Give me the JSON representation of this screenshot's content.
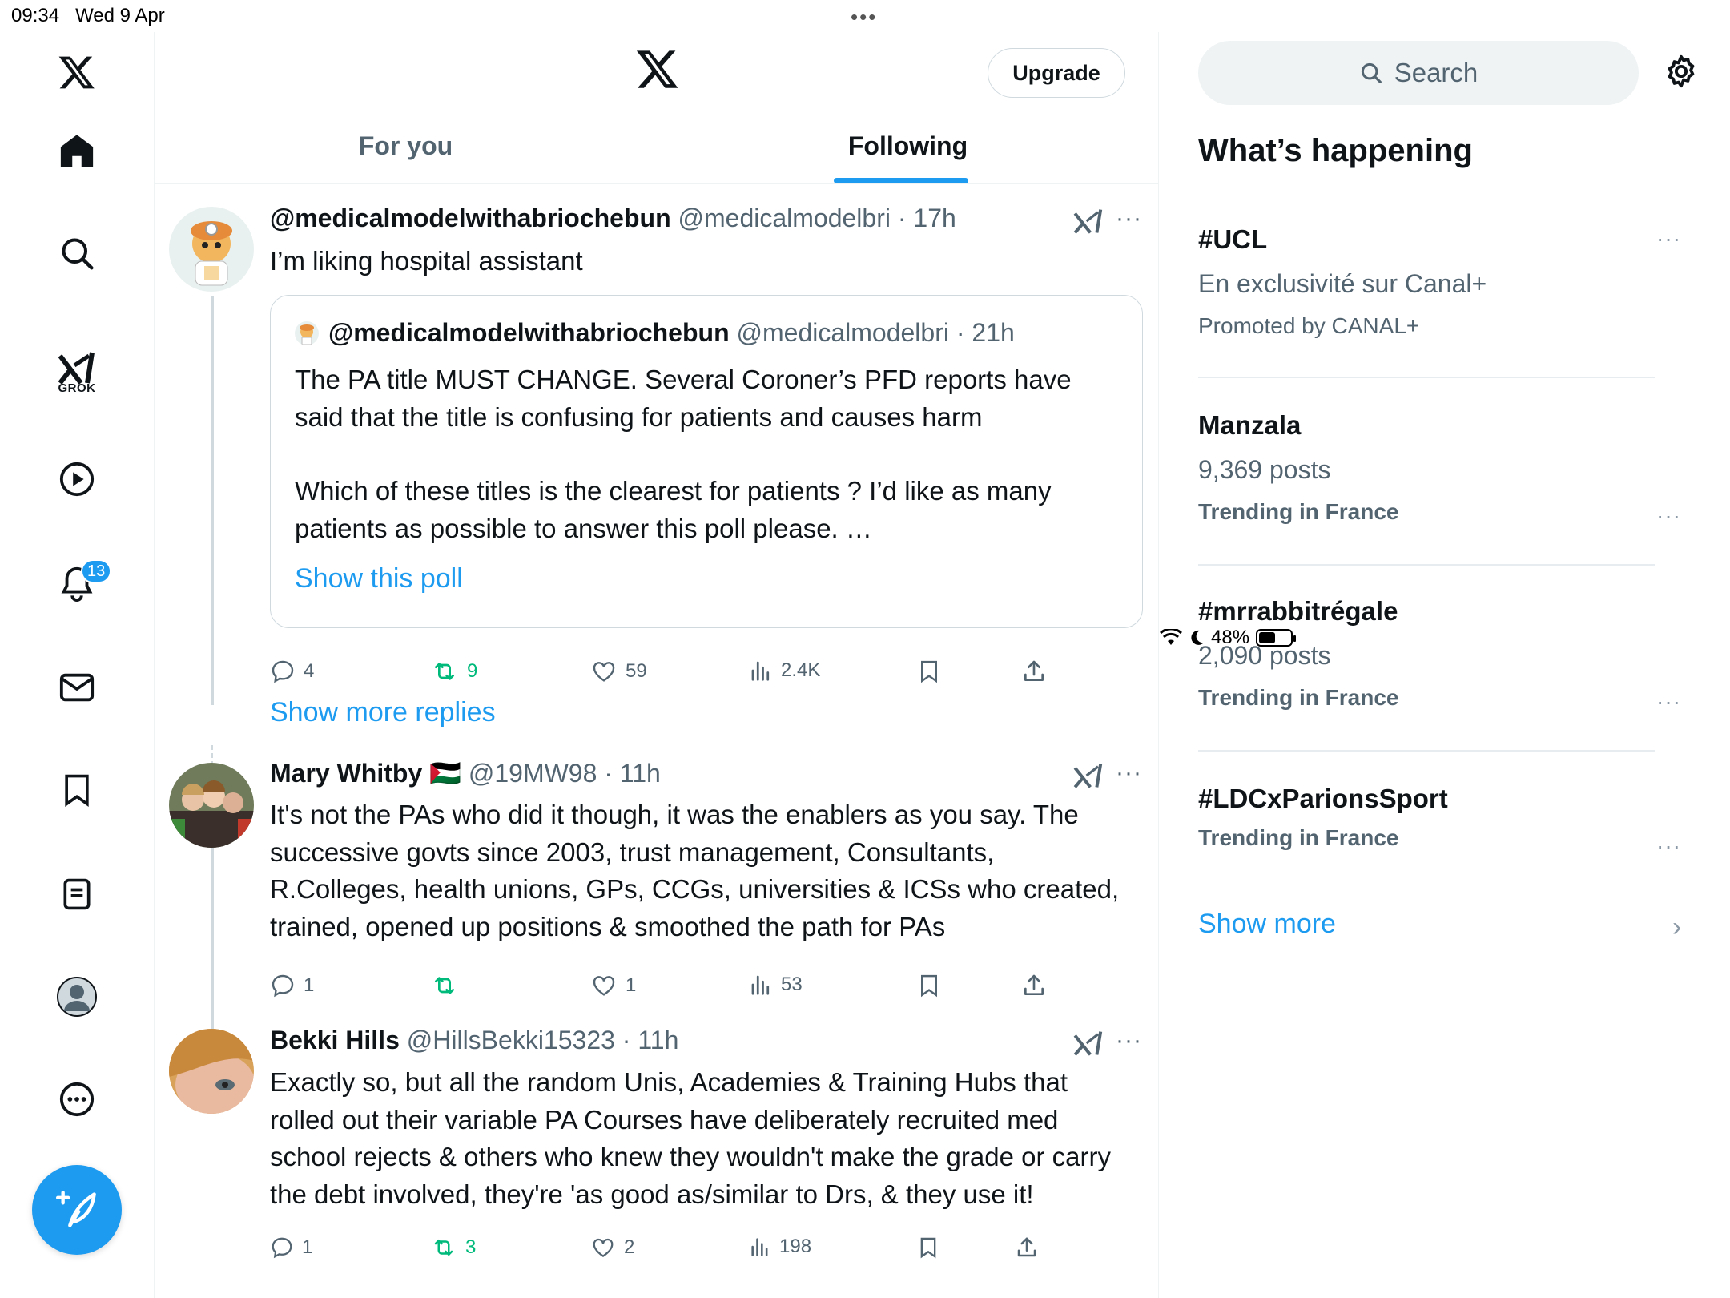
{
  "status_bar": {
    "time": "09:34",
    "date": "Wed 9 Apr",
    "battery": "48%",
    "battery_level": 0.48
  },
  "left_nav": {
    "items": [
      {
        "icon": "x-logo-icon"
      },
      {
        "icon": "home-icon"
      },
      {
        "icon": "search-icon"
      },
      {
        "icon": "grok-icon",
        "label": "GROK"
      },
      {
        "icon": "play-icon"
      },
      {
        "icon": "bell-icon",
        "badge": "13"
      },
      {
        "icon": "mail-icon"
      },
      {
        "icon": "bookmark-icon"
      },
      {
        "icon": "list-icon"
      },
      {
        "icon": "profile-icon"
      },
      {
        "icon": "more-icon"
      }
    ],
    "compose_icon": "compose-icon"
  },
  "header": {
    "upgrade_label": "Upgrade",
    "tabs": [
      {
        "label": "For you",
        "active": false
      },
      {
        "label": "Following",
        "active": true
      }
    ]
  },
  "tweets": [
    {
      "name": "@medicalmodelwithabriochebun",
      "handle": "@medicalmodelbri",
      "time": "17h",
      "text": "I’m liking hospital assistant",
      "quote": {
        "name": "@medicalmodelwithabriochebun",
        "handle": "@medicalmodelbri",
        "time": "21h",
        "text_1": "The PA title MUST CHANGE. Several Coroner’s PFD reports have said that the title is confusing for patients and causes harm",
        "text_2": "Which of these titles is the clearest for patients ? I’d like as many patients as possible to answer this poll please. …",
        "poll_link": "Show this poll"
      },
      "replies": "4",
      "retweets": "9",
      "likes": "59",
      "views": "2.4K"
    },
    {
      "name": "Mary Whitby",
      "flag": "🇵🇸",
      "handle": "@19MW98",
      "time": "11h",
      "text": "It's not the PAs who did it though,  it was the enablers as you say. The successive govts since 2003, trust management,  Consultants, R.Colleges, health unions, GPs, CCGs, universities  & ICSs who created, trained, opened up positions & smoothed the path for PAs",
      "replies": "1",
      "retweets": "",
      "likes": "1",
      "views": "53"
    },
    {
      "name": "Bekki Hills",
      "handle": "@HillsBekki15323",
      "time": "11h",
      "text": "Exactly so, but all the random Unis, Academies & Training Hubs that rolled out their variable PA Courses have deliberately recruited med school rejects & others who knew they wouldn't make the grade or carry the debt involved, they're 'as good as/similar to Drs, & they use it!",
      "replies": "1",
      "retweets": "3",
      "likes": "2",
      "views": "198"
    }
  ],
  "show_more_replies": "Show more replies",
  "sidebar": {
    "search_placeholder": "Search",
    "title": "What’s happening",
    "trends": [
      {
        "title": "#UCL",
        "subtitle": "En exclusivité sur Canal+",
        "meta": "Promoted by CANAL+"
      },
      {
        "title": "Manzala",
        "subtitle": "9,369 posts",
        "meta": "Trending in France"
      },
      {
        "title": "#mrrabbitrégale",
        "subtitle": "2,090 posts",
        "meta": "Trending in France"
      },
      {
        "title": "#LDCxParionsSport",
        "subtitle": "",
        "meta": "Trending in France"
      }
    ],
    "show_more": "Show more"
  },
  "colors": {
    "accent": "#1d9bf0",
    "retweet": "#00ba7c",
    "secondary_text": "#536471",
    "primary_text": "#0f1419"
  }
}
